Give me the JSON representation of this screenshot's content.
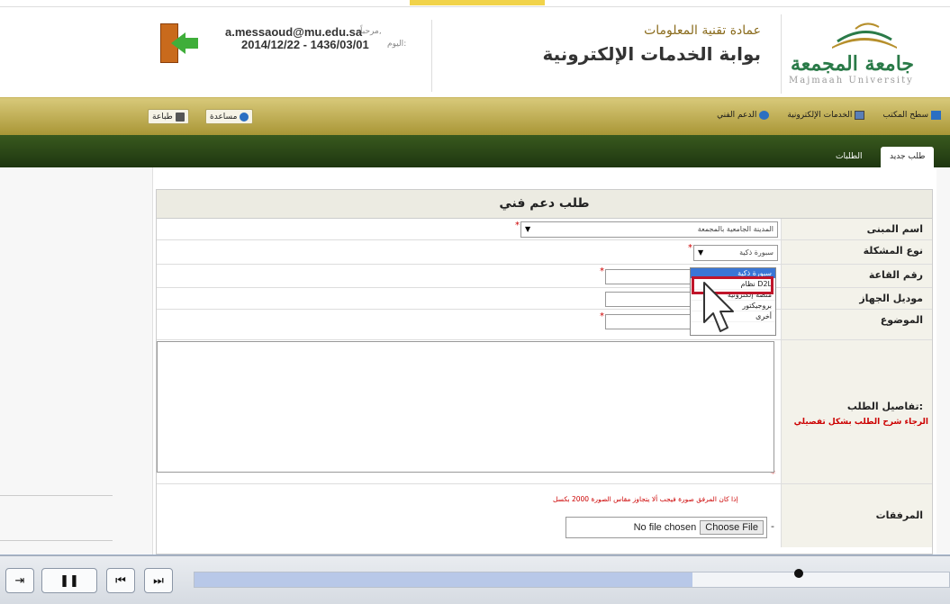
{
  "user": {
    "welcome_label": "مرحباً,",
    "email": "a.messaoud@mu.edu.sa",
    "today_label": "اليوم:",
    "date": "2014/12/22 - 1436/03/01"
  },
  "brand": {
    "deanship": "عمادة تقنية المعلومات",
    "portal_title": "بوابة الخدمات الإلكترونية",
    "university_ar": "جامعة المجمعة",
    "university_en": "Majmaah University"
  },
  "toolbar": {
    "print_label": "طباعة",
    "help_label": "مساعدة",
    "nav": [
      "سطح المكتب",
      "الخدمات الإلكترونية",
      "الدعم الفني"
    ]
  },
  "tabs": [
    {
      "label": "طلب جديد",
      "active": true
    },
    {
      "label": "الطلبات",
      "active": false
    }
  ],
  "form": {
    "title": "طلب دعم فني",
    "building_label": "اسم المبنى",
    "building_value": "المدينة الجامعية بالمجمعة",
    "problem_label": "نوع المشكلة",
    "problem_value": "سبورة ذكية",
    "room_label": "رقم القاعة",
    "device_label": "موديل الجهاز",
    "subject_label": "الموضوع",
    "details_label": "تفاصيل الطلب:",
    "details_hint": "الرجاء شرح الطلب بشكل تفصيلي",
    "attachments_label": "المرفقات",
    "attach_note": "إذا كان المرفق صورة فيجب ألا يتجاوز مقاس الصورة 2000 بكسل",
    "file_status": "No file chosen",
    "file_button": "Choose File",
    "required_mark": "*",
    "dropdown_options": [
      "سبورة ذكية",
      "نظام D2L",
      "منصة إلكترونية",
      "بروجيكتور",
      "أخرى"
    ],
    "dropdown_highlighted": "سبورة ذكية"
  },
  "player": {
    "progress": 0.66,
    "buttons": [
      "exit-icon",
      "pause-icon",
      "previous-icon",
      "next-icon"
    ]
  }
}
